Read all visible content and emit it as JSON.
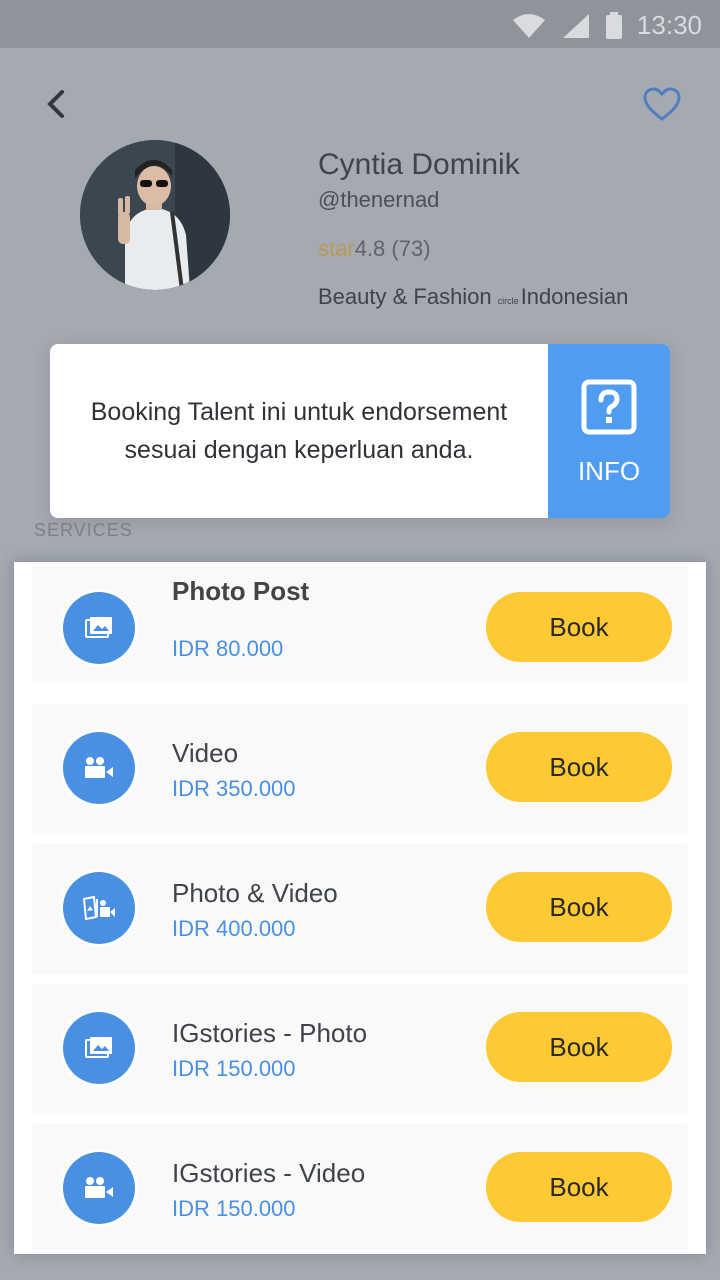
{
  "status": {
    "time": "13:30"
  },
  "profile": {
    "name": "Cyntia Dominik",
    "handle": "@thenernad",
    "rating_icon_text": "star",
    "rating": "4.8",
    "reviews": "(73)",
    "category": "Beauty & Fashion",
    "separator": "circle",
    "nationality": "Indonesian"
  },
  "info_card": {
    "message": "Booking Talent ini untuk endorsement sesuai dengan keperluan anda.",
    "button_label": "INFO"
  },
  "services_label": "SERVICES",
  "services": [
    {
      "title": "Photo Post",
      "price": "IDR 80.000",
      "icon": "image-icon",
      "book_label": "Book"
    },
    {
      "title": "Video",
      "price": "IDR 350.000",
      "icon": "video-camera-icon",
      "book_label": "Book"
    },
    {
      "title": "Photo & Video",
      "price": "IDR 400.000",
      "icon": "photo-video-icon",
      "book_label": "Book"
    },
    {
      "title": "IGstories - Photo",
      "price": "IDR 150.000",
      "icon": "image-icon",
      "book_label": "Book"
    },
    {
      "title": "IGstories - Video",
      "price": "IDR 150.000",
      "icon": "video-camera-icon",
      "book_label": "Book"
    }
  ],
  "colors": {
    "accent_blue": "#4a90e2",
    "book_yellow": "#fdc935",
    "info_blue": "#4f9cf0"
  }
}
